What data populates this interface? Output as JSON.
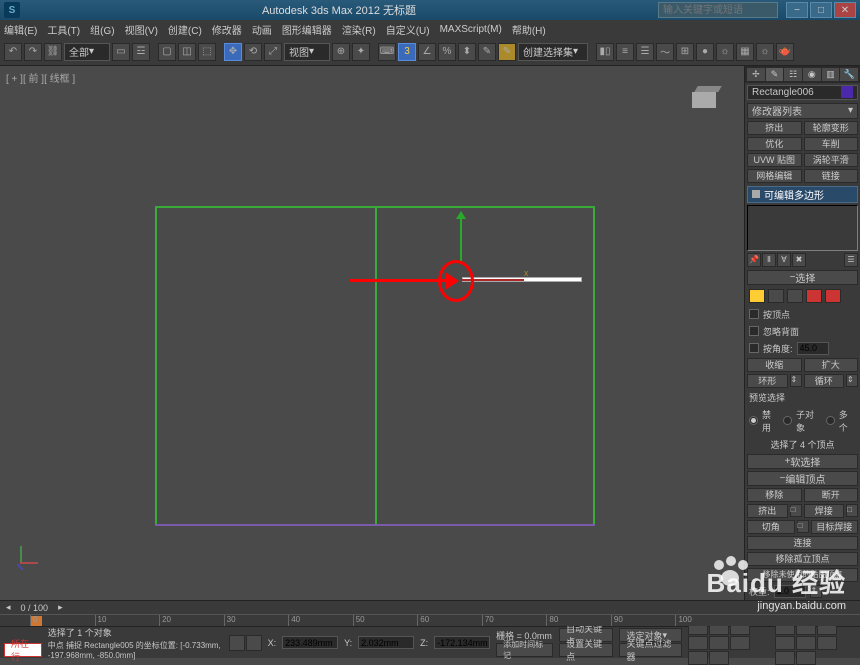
{
  "title": "Autodesk 3ds Max 2012        无标题",
  "search_placeholder": "输入关键字或短语",
  "menu": [
    "编辑(E)",
    "工具(T)",
    "组(G)",
    "视图(V)",
    "创建(C)",
    "修改器",
    "动画",
    "图形编辑器",
    "渲染(R)",
    "自定义(U)",
    "MAXScript(M)",
    "帮助(H)"
  ],
  "toolbar": {
    "dropdown1": "全部",
    "dropdown2": "视图",
    "snap_label": "3",
    "named_sel": "创建选择集"
  },
  "viewport": {
    "label": "[ + ][ 前 ][ 线框 ]",
    "gizmo_x": "x"
  },
  "right": {
    "object_name": "Rectangle006",
    "mod_list_label": "修改器列表",
    "btns1": [
      "挤出",
      "轮廓变形"
    ],
    "btns2": [
      "优化",
      "车削"
    ],
    "btns3": [
      "UVW 贴图",
      "涡轮平滑"
    ],
    "btns4": [
      "网格编辑",
      "链接"
    ],
    "stack_item": "可编辑多边形",
    "rollout_sel": "选择",
    "chk_vertex": "按顶点",
    "chk_backface": "忽略背面",
    "chk_angle": "按角度:",
    "angle_val": "45.0",
    "shrink": "收缩",
    "grow": "扩大",
    "ring": "环形",
    "loop": "循环",
    "preview_label": "预览选择",
    "radio_off": "禁用",
    "radio_sub": "子对象",
    "radio_multi": "多个",
    "sel_status": "选择了 4 个顶点",
    "rollout_soft": "软选择",
    "rollout_edit": "编辑顶点",
    "edit_btns": [
      [
        "移除",
        "断开"
      ],
      [
        "挤出",
        "焊接"
      ],
      [
        "切角",
        "目标焊接"
      ]
    ],
    "connect": "连接",
    "remove_iso": "移除孤立顶点",
    "remove_unused": "移除未使用的贴图顶点",
    "weight_label": "权重:",
    "weight_val": "1.0"
  },
  "timeline": {
    "frame": "0 / 100",
    "ticks": [
      "0",
      "10",
      "20",
      "30",
      "40",
      "50",
      "60",
      "70",
      "80",
      "90",
      "100"
    ]
  },
  "status": {
    "nowbtn": "所在行",
    "sel_count": "选择了 1 个对象",
    "coord_prefix": "中点 捕捉 Rectangle005 的坐标位置:",
    "coord_val": "[-0.733mm, -197.968mm, -850.0mm]",
    "x_label": "X:",
    "x_val": "233.489mm",
    "y_label": "Y:",
    "y_val": "2.032mm",
    "z_label": "Z:",
    "z_val": "-172.134mm",
    "grid": "栅格 = 0.0mm",
    "addtime": "添加时间标记",
    "autokey": "自动关键点",
    "selobj": "选定对象",
    "setkey": "设置关键点",
    "keyfilter": "关键点过滤器"
  },
  "watermark": {
    "brand": "Baidu 经验",
    "url": "jingyan.baidu.com"
  }
}
